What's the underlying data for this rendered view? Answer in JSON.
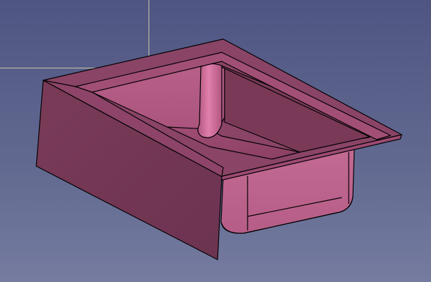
{
  "viewer": {
    "background_top": "#4f5582",
    "background_bottom": "#767ca0",
    "selection_box_color": "#c9c6a6"
  },
  "model": {
    "shape": "sink-basin-with-front-apron",
    "face_color": "#b0577d",
    "edge_color": "#000000"
  }
}
